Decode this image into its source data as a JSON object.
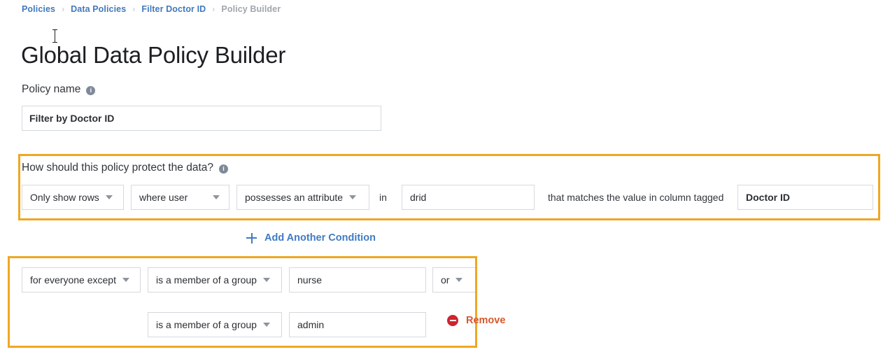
{
  "breadcrumb": {
    "separator": "›",
    "items": [
      {
        "label": "Policies",
        "current": false
      },
      {
        "label": "Data Policies",
        "current": false
      },
      {
        "label": "Filter Doctor ID",
        "current": false
      },
      {
        "label": "Policy Builder",
        "current": true
      }
    ]
  },
  "page": {
    "title": "Global Data Policy Builder"
  },
  "policy_name": {
    "label": "Policy name",
    "info_icon": "info-icon",
    "info_glyph": "i",
    "value": "Filter by Doctor ID",
    "placeholder": "Policy name"
  },
  "protect_section": {
    "label": "How should this policy protect the data?",
    "info_icon": "info-icon",
    "info_glyph": "i",
    "action_select": {
      "value": "Only show rows",
      "icon": "chevron-down-icon"
    },
    "subject_select": {
      "value": "where user",
      "icon": "chevron-down-icon"
    },
    "predicate_select": {
      "value": "possesses an attribute",
      "icon": "chevron-down-icon"
    },
    "joiner_text": "in",
    "attribute_value": "drid",
    "match_text": "that matches the value in column tagged",
    "column_tag_value": "Doctor ID"
  },
  "add_condition": {
    "label": "Add Another Condition",
    "icon": "plus-icon"
  },
  "group_section": {
    "rows": [
      {
        "scope_select": {
          "value": "for everyone except",
          "icon": "chevron-down-icon"
        },
        "membership_select": {
          "value": "is a member of a group",
          "icon": "chevron-down-icon"
        },
        "group_value": "nurse",
        "operator_select": {
          "value": "or",
          "icon": "chevron-down-icon"
        }
      },
      {
        "membership_select": {
          "value": "is a member of a group",
          "icon": "chevron-down-icon"
        },
        "group_value": "admin"
      }
    ],
    "remove": {
      "label": "Remove",
      "icon": "minus-circle-icon"
    }
  },
  "colors": {
    "highlight_border": "#efa722",
    "link_blue": "#4179bd",
    "remove_red": "#d7582c",
    "remove_icon_red": "#cf2430",
    "muted_text": "#a0a6ad",
    "field_border": "#d5d9dd"
  }
}
